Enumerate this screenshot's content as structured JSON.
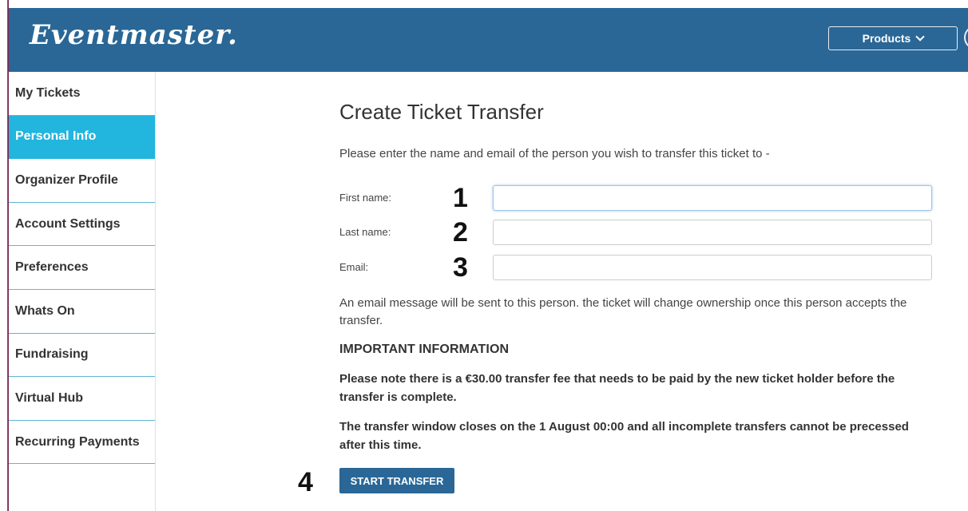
{
  "header": {
    "logo": "Eventmaster.",
    "products_label": "Products"
  },
  "sidebar": {
    "items": [
      {
        "label": "My Tickets",
        "active": false
      },
      {
        "label": "Personal Info",
        "active": true
      },
      {
        "label": "Organizer Profile",
        "active": false
      },
      {
        "label": "Account Settings",
        "active": false
      },
      {
        "label": "Preferences",
        "active": false
      },
      {
        "label": "Whats On",
        "active": false
      },
      {
        "label": "Fundraising",
        "active": false
      },
      {
        "label": "Virtual Hub",
        "active": false
      },
      {
        "label": "Recurring Payments",
        "active": false
      }
    ]
  },
  "main": {
    "title": "Create Ticket Transfer",
    "intro": "Please enter the name and email of the person you wish to transfer this ticket to -",
    "fields": [
      {
        "label": "First name:",
        "marker": "1",
        "value": "",
        "placeholder": ""
      },
      {
        "label": "Last name:",
        "marker": "2",
        "value": "",
        "placeholder": ""
      },
      {
        "label": "Email:",
        "marker": "3",
        "value": "",
        "placeholder": ""
      }
    ],
    "notice": "An email message will be sent to this person. the ticket will change ownership once this person accepts the transfer.",
    "important_heading": "IMPORTANT INFORMATION",
    "fee_text": "Please note there is a €30.00 transfer fee that needs to be paid by the new ticket holder before the transfer is complete.",
    "window_text": "The transfer window closes on the 1 August 00:00 and all incomplete transfers cannot be precessed after this time.",
    "button_marker": "4",
    "start_button": "START TRANSFER"
  },
  "colors": {
    "header_bg": "#2a6796",
    "active_item_bg": "#22b5dd",
    "button_bg": "#2a6796"
  }
}
